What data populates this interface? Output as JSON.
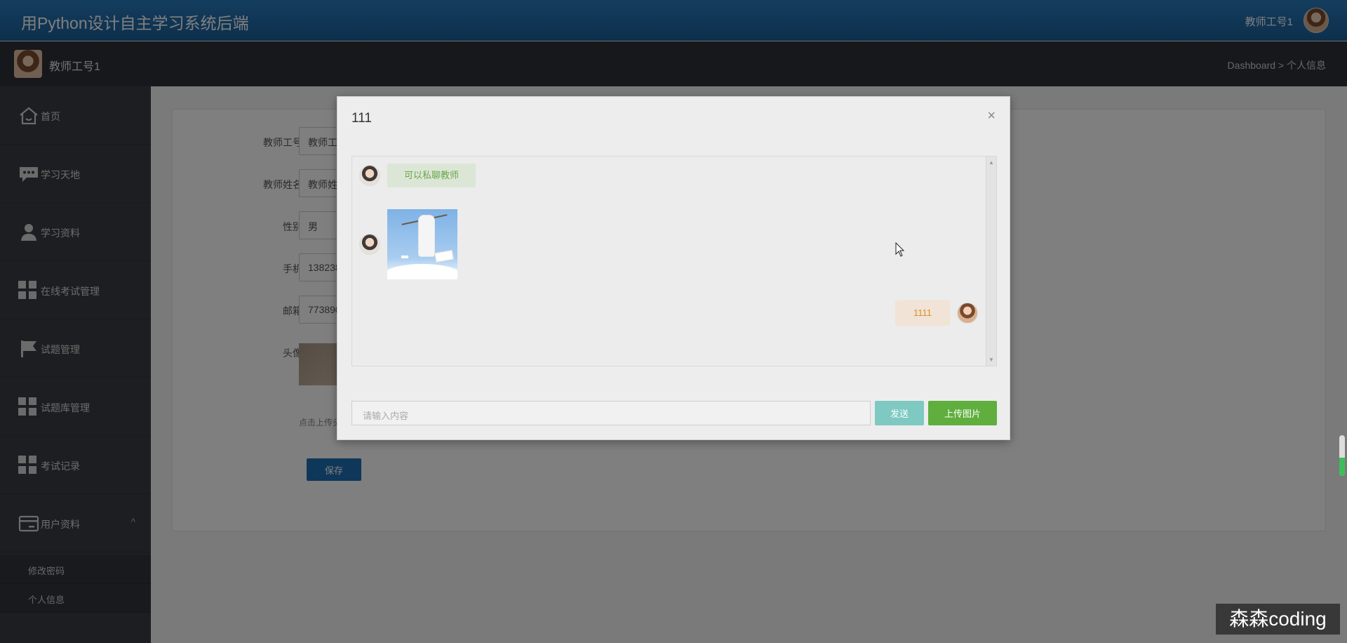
{
  "app": {
    "title": "用Python设计自主学习系统后端",
    "user_name": "教师工号1"
  },
  "subbar": {
    "user_name": "教师工号1",
    "breadcrumb": "Dashboard > 个人信息"
  },
  "sidebar": {
    "items": [
      {
        "label": "首页",
        "icon": "home-icon"
      },
      {
        "label": "学习天地",
        "icon": "chat-icon"
      },
      {
        "label": "学习资料",
        "icon": "user-icon"
      },
      {
        "label": "在线考试管理",
        "icon": "grid-icon"
      },
      {
        "label": "试题管理",
        "icon": "flag-icon"
      },
      {
        "label": "试题库管理",
        "icon": "grid-icon"
      },
      {
        "label": "考试记录",
        "icon": "grid-icon"
      },
      {
        "label": "用户资料",
        "icon": "card-icon",
        "chevron": "^"
      }
    ],
    "subitems": [
      {
        "label": "修改密码"
      },
      {
        "label": "个人信息"
      }
    ]
  },
  "form": {
    "fields": [
      {
        "label": "教师工号",
        "value": "教师工"
      },
      {
        "label": "教师姓名",
        "value": "教师姓"
      },
      {
        "label": "性别",
        "value": "男"
      },
      {
        "label": "手机",
        "value": "138238"
      },
      {
        "label": "邮箱",
        "value": "773890"
      }
    ],
    "avatar_label": "头像",
    "upload_hint": "点击上传头",
    "save_label": "保存"
  },
  "modal": {
    "title": "111",
    "close": "×",
    "messages": [
      {
        "side": "left",
        "type": "text",
        "text": "可以私聊教师"
      },
      {
        "side": "left",
        "type": "image"
      },
      {
        "side": "right",
        "type": "text",
        "text": "1111"
      }
    ],
    "input_placeholder": "请输入内容",
    "send_label": "发送",
    "upload_label": "上传图片"
  },
  "watermark": "森森coding",
  "colors": {
    "header": "#1a5f99",
    "sidebar": "#3a3d43",
    "send": "#7ec9c2",
    "upload": "#5fae3e",
    "save": "#1f6fb4"
  }
}
